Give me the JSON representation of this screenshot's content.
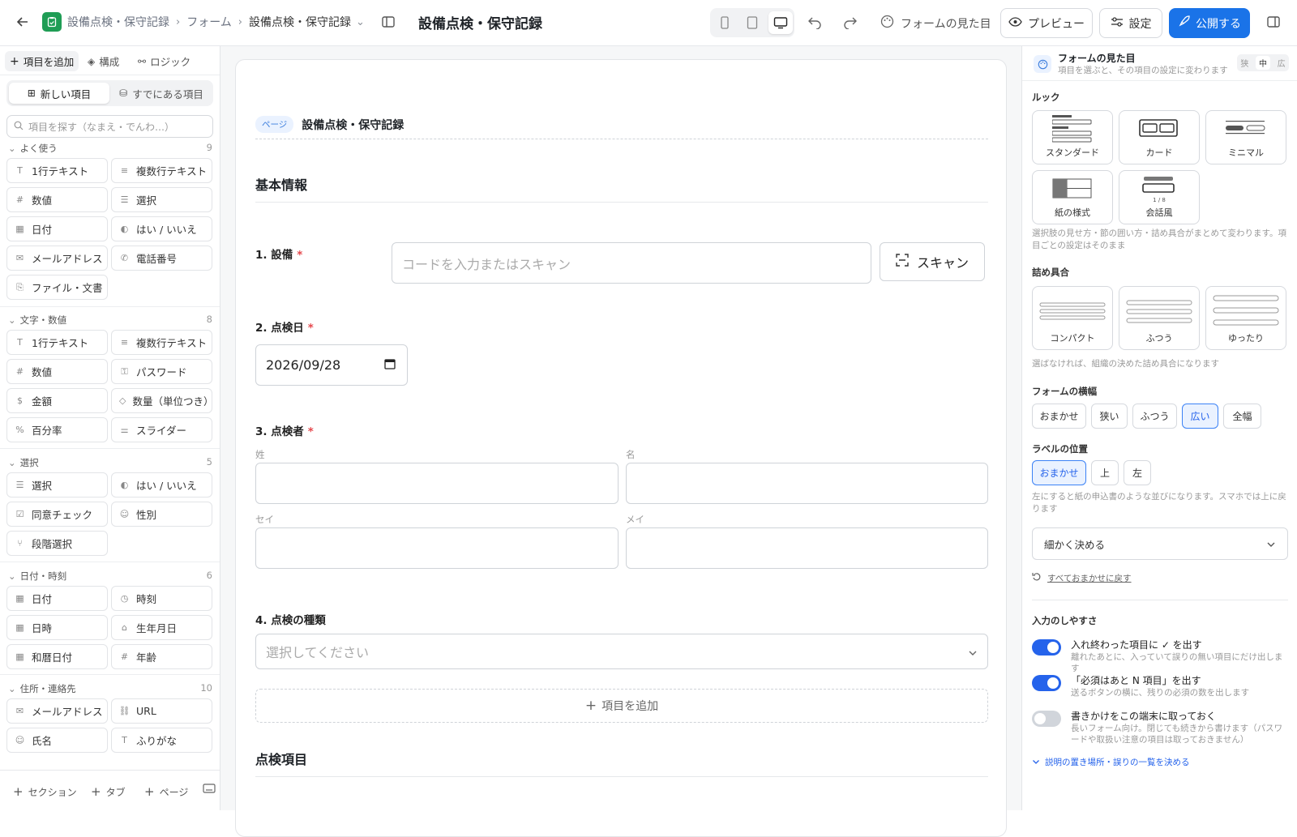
{
  "topbar": {
    "crumb1": "設備点検・保守記録",
    "crumb2": "フォーム",
    "crumb3": "設備点検・保守記録",
    "title": "設備点検・保守記録",
    "appearance_label": "フォームの見た目",
    "preview_label": "プレビュー",
    "settings_label": "設定",
    "publish_label": "公開する",
    "accent": "#1a73e8"
  },
  "left": {
    "tabs": [
      "項目を追加",
      "構成",
      "ロジック"
    ],
    "seg": [
      "新しい項目",
      "すでにある項目"
    ],
    "search_placeholder": "項目を探す（なまえ・でんわ…）",
    "categories": [
      {
        "name": "よく使う",
        "count": "9",
        "items": [
          {
            "icon": "T",
            "label": "1行テキスト"
          },
          {
            "icon": "≡",
            "label": "複数行テキスト"
          },
          {
            "icon": "#",
            "label": "数値"
          },
          {
            "icon": "☰",
            "label": "選択"
          },
          {
            "icon": "▦",
            "label": "日付"
          },
          {
            "icon": "◐",
            "label": "はい / いいえ"
          },
          {
            "icon": "✉",
            "label": "メールアドレス"
          },
          {
            "icon": "✆",
            "label": "電話番号"
          },
          {
            "icon": "⎘",
            "label": "ファイル・文書"
          }
        ]
      },
      {
        "name": "文字・数値",
        "count": "8",
        "items": [
          {
            "icon": "T",
            "label": "1行テキスト"
          },
          {
            "icon": "≡",
            "label": "複数行テキスト"
          },
          {
            "icon": "#",
            "label": "数値"
          },
          {
            "icon": "⚿",
            "label": "パスワード"
          },
          {
            "icon": "$",
            "label": "金額"
          },
          {
            "icon": "◇",
            "label": "数量（単位つき）"
          },
          {
            "icon": "%",
            "label": "百分率"
          },
          {
            "icon": "⚌",
            "label": "スライダー"
          }
        ]
      },
      {
        "name": "選択",
        "count": "5",
        "items": [
          {
            "icon": "☰",
            "label": "選択"
          },
          {
            "icon": "◐",
            "label": "はい / いいえ"
          },
          {
            "icon": "☑",
            "label": "同意チェック"
          },
          {
            "icon": "☺",
            "label": "性別"
          },
          {
            "icon": "⑂",
            "label": "段階選択"
          }
        ]
      },
      {
        "name": "日付・時刻",
        "count": "6",
        "items": [
          {
            "icon": "▦",
            "label": "日付"
          },
          {
            "icon": "◷",
            "label": "時刻"
          },
          {
            "icon": "▦",
            "label": "日時"
          },
          {
            "icon": "⌂",
            "label": "生年月日"
          },
          {
            "icon": "▦",
            "label": "和暦日付"
          },
          {
            "icon": "#",
            "label": "年齢"
          }
        ]
      },
      {
        "name": "住所・連絡先",
        "count": "10",
        "items": [
          {
            "icon": "✉",
            "label": "メールアドレス"
          },
          {
            "icon": "⛓",
            "label": "URL"
          },
          {
            "icon": "☺",
            "label": "氏名"
          },
          {
            "icon": "T",
            "label": "ふりがな"
          }
        ]
      }
    ],
    "bottom": [
      "セクション",
      "タブ",
      "ページ"
    ]
  },
  "form": {
    "page_pill": "ページ",
    "page_title": "設備点検・保守記録",
    "section1": "基本情報",
    "q1_label": "1. 設備",
    "q1_placeholder": "コードを入力またはスキャン",
    "scan_label": "スキャン",
    "q2_label": "2. 点検日",
    "q2_value": "2026/09/28",
    "q3_label": "3. 点検者",
    "sub_sei": "姓",
    "sub_mei": "名",
    "sub_sei_kana": "セイ",
    "sub_mei_kana": "メイ",
    "q4_label": "4. 点検の種類",
    "q4_placeholder": "選択してください",
    "add_item": "項目を追加",
    "section2": "点検項目",
    "required_mark": "*"
  },
  "right": {
    "header_title": "フォームの見た目",
    "header_sub": "項目を選ぶと、その項目の設定に変わります",
    "size_chips": [
      "狭",
      "中",
      "広"
    ],
    "look_heading": "ルック",
    "looks": [
      "スタンダード",
      "カード",
      "ミニマル",
      "紙の様式",
      "会話風"
    ],
    "look_page": "1 / 8",
    "look_note": "選択肢の見せ方・節の囲い方・詰め具合がまとめて変わります。項目ごとの設定はそのまま",
    "density_heading": "詰め具合",
    "densities": [
      "コンパクト",
      "ふつう",
      "ゆったり"
    ],
    "density_note": "選ばなければ、組織の決めた詰め具合になります",
    "width_heading": "フォームの横幅",
    "widths": [
      "おまかせ",
      "狭い",
      "ふつう",
      "広い",
      "全幅"
    ],
    "label_heading": "ラベルの位置",
    "label_positions": [
      "おまかせ",
      "上",
      "左"
    ],
    "label_note": "左にすると紙の申込書のような並びになります。スマホでは上に戻ります",
    "fine_tune": "細かく決める",
    "reset": "すべておまかせに戻す",
    "ease_heading": "入力のしやすさ",
    "toggles": [
      {
        "title": "入れ終わった項目に ✓ を出す",
        "desc": "離れたあとに、入っていて誤りの無い項目にだけ出します",
        "on": true
      },
      {
        "title": "「必須はあと N 項目」を出す",
        "desc": "送るボタンの横に、残りの必須の数を出します",
        "on": true
      },
      {
        "title": "書きかけをこの端末に取っておく",
        "desc": "長いフォーム向け。閉じても続きから書けます（パスワードや取扱い注意の項目は取っておきません）",
        "on": false
      }
    ],
    "more_link": "説明の置き場所・誤りの一覧を決める"
  }
}
